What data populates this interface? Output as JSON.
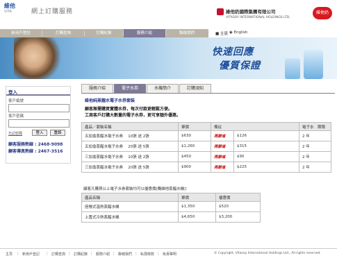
{
  "header": {
    "logo_text": "維他",
    "logo_sub": "VITA",
    "brand_tag": "網上訂購服務",
    "corp_name_zh": "維他奶國際集團有限公司",
    "corp_name_en": "VITASOY INTERNATIONAL HOLDINGS LTD.",
    "vitasoy_logo": "維他奶"
  },
  "nav": {
    "items": [
      "新用戶登記",
      "訂購查詢",
      "訂購紀錄",
      "服務介紹",
      "聯絡我們"
    ],
    "active_index": 3,
    "home_label": "主頁",
    "english_label": "English"
  },
  "banner": {
    "line1": "快速回應",
    "line2": "優質保證"
  },
  "login": {
    "title": "登入",
    "account_label": "客戶編號",
    "password_label": "客戶密碼",
    "forgot_label": "忘記密碼",
    "login_button": "登入",
    "reset_button": "重設",
    "hotline1": "顧客服務熱線 : 2468-9098",
    "hotline2": "顧客傳真熱線 : 2467-3516"
  },
  "tabs": [
    "服務介紹",
    "電子水券",
    "水機簡介",
    "訂購須知"
  ],
  "active_tab": 1,
  "content": {
    "title": "維他純蒸餾水電子水券套裝",
    "para1": "顧客無需購買實體水券，每次付款更輕鬆方便。",
    "para2": "工商客戶訂購大數量的電子水券，更可享額外優惠。",
    "table1": {
      "headers": [
        "產品／套裝名稱",
        "單價",
        "備註",
        "電子水　期限"
      ],
      "rows": [
        [
          "五加侖蒸餾水電子水券　 10張 送 2張",
          "$630",
          "再節省",
          "$126",
          "2 年"
        ],
        [
          "五加侖蒸餾水電子水券　 20張 送 5張",
          "$1,260",
          "再節省",
          "$315",
          "2 年"
        ],
        [
          "三加侖蒸餾水電子水券　 10張 送 2張",
          "$450",
          "再節省",
          "$90",
          "2 年"
        ],
        [
          "三加侖蒸餾水電子水券　 20張 送 5張",
          "$900",
          "再節省",
          "$225",
          "2 年"
        ]
      ]
    },
    "note": "顧客凡購買以上電子水券套裝均可以優惠價[購維他蒸餾水機]：",
    "table2": {
      "headers": [
        "產品名稱",
        "單價",
        "優惠價"
      ],
      "rows": [
        [
          "座檯式溫熱蒸餾水機",
          "$1,350",
          "$520"
        ],
        [
          "上置式冷熱蒸餾水機",
          "$4,650",
          "$3,200"
        ]
      ]
    }
  },
  "footer": {
    "links": [
      "主頁",
      "新用戶登記",
      "訂購查詢",
      "訂購紀錄",
      "服務介紹",
      "聯絡我們",
      "私隱條款",
      "免責聲明"
    ],
    "copyright": "© Copyright, Vitasoy International Holdings Ltd., All rights reserved."
  },
  "colors": {
    "nav_bg": "#b9b4a7",
    "active_tab": "#7f7a96",
    "title_blue": "#2a3a88",
    "offer_red": "#c40000"
  }
}
